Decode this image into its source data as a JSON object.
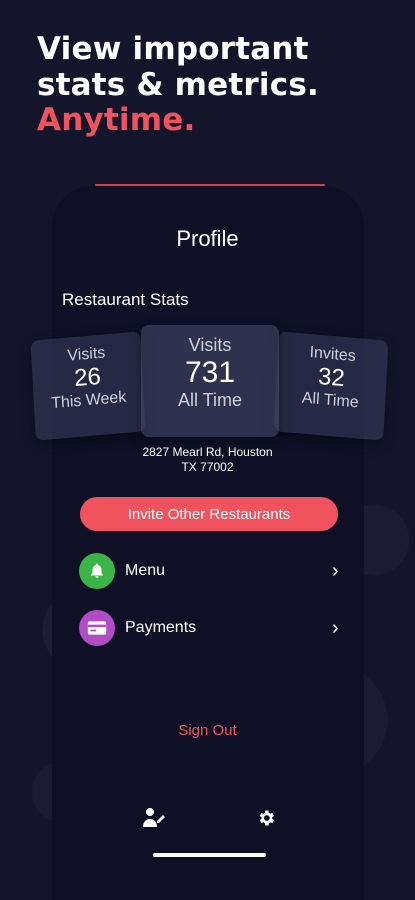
{
  "headline": {
    "line1": "View important",
    "line2": "stats & metrics.",
    "line3": "Anytime."
  },
  "screen": {
    "title": "Profile",
    "section_title": "Restaurant Stats",
    "stats": {
      "left": {
        "label": "Visits",
        "value": "26",
        "sub": "This Week"
      },
      "center": {
        "label": "Visits",
        "value": "731",
        "sub": "All Time"
      },
      "right": {
        "label": "Invites",
        "value": "32",
        "sub": "All Time"
      }
    },
    "address_line1": "2827 Mearl Rd, Houston",
    "address_line2": "TX 77002",
    "invite_button": "Invite Other Restaurants",
    "menu_items": [
      {
        "label": "Menu",
        "icon": "bell-icon",
        "color": "#3ab545"
      },
      {
        "label": "Payments",
        "icon": "card-icon",
        "color": "#b24bc6"
      }
    ],
    "chevron": "›",
    "sign_out": "Sign Out"
  },
  "colors": {
    "accent": "#f0525e",
    "background": "#14152b"
  }
}
